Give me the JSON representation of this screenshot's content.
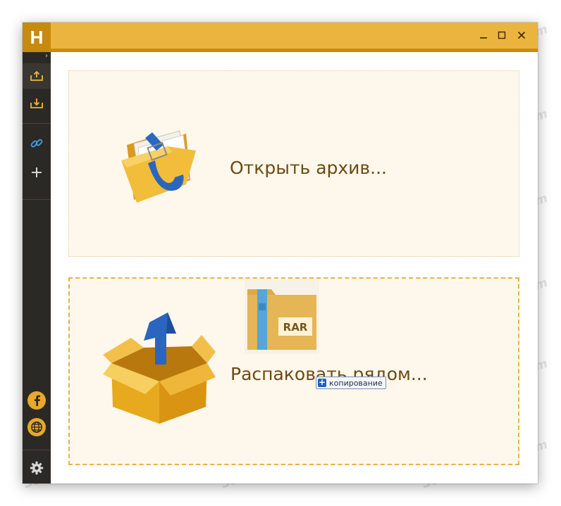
{
  "app": {
    "logo_letter": "H"
  },
  "window_controls": {
    "minimize": "—",
    "maximize": "☐",
    "close": "✕"
  },
  "sidebar": {
    "expand": "›",
    "items": [
      {
        "icon": "archive-add-icon",
        "active": true
      },
      {
        "icon": "archive-extract-icon",
        "active": false
      },
      {
        "icon": "link-icon",
        "active": false
      },
      {
        "icon": "plus-icon",
        "active": false
      }
    ],
    "social": [
      {
        "icon": "facebook-icon"
      },
      {
        "icon": "globe-icon"
      }
    ],
    "settings_icon": "gear-icon"
  },
  "panels": {
    "open_label": "Открыть архив...",
    "extract_label": "Распаковать рядом..."
  },
  "drag": {
    "file_badge": "RAR",
    "tooltip": "копирование"
  },
  "colors": {
    "accent": "#ebb43f",
    "accent_dark": "#c88a10",
    "sidebar": "#2b2926",
    "panel_bg": "#fef8ec"
  },
  "watermark": "Soringpcrepair.com"
}
